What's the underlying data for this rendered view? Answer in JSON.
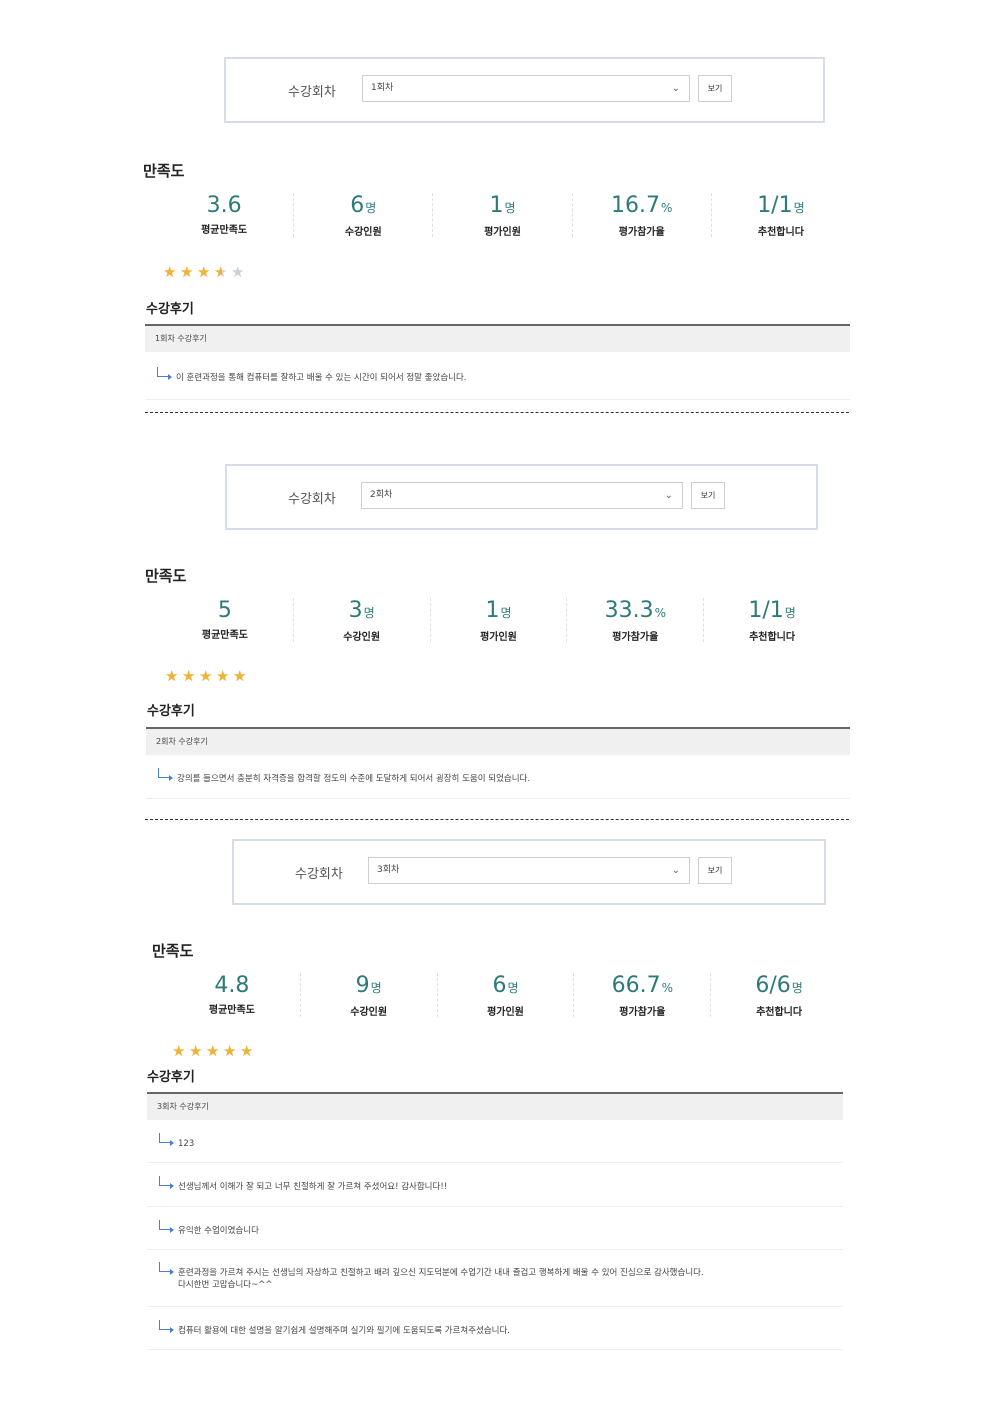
{
  "sections": [
    {
      "filter": {
        "label": "수강회차",
        "selected": "1회차",
        "button": "보기"
      },
      "satisfaction_title": "만족도",
      "stats": [
        {
          "value": "3.6",
          "unit": "",
          "label": "평균만족도"
        },
        {
          "value": "6",
          "unit": "명",
          "label": "수강인원"
        },
        {
          "value": "1",
          "unit": "명",
          "label": "평가인원"
        },
        {
          "value": "16.7",
          "unit": "%",
          "label": "평가참가율"
        },
        {
          "value": "1/1",
          "unit": "명",
          "label": "추천합니다"
        }
      ],
      "rating": 3.6,
      "review_title": "수강후기",
      "review_header": "1회차 수강후기",
      "reviews": [
        "이 훈련과정을 통해 컴퓨터를 잘하고 배울 수 있는 시간이 되어서 정말 좋았습니다."
      ]
    },
    {
      "filter": {
        "label": "수강회차",
        "selected": "2회차",
        "button": "보기"
      },
      "satisfaction_title": "만족도",
      "stats": [
        {
          "value": "5",
          "unit": "",
          "label": "평균만족도"
        },
        {
          "value": "3",
          "unit": "명",
          "label": "수강인원"
        },
        {
          "value": "1",
          "unit": "명",
          "label": "평가인원"
        },
        {
          "value": "33.3",
          "unit": "%",
          "label": "평가참가율"
        },
        {
          "value": "1/1",
          "unit": "명",
          "label": "추천합니다"
        }
      ],
      "rating": 5,
      "review_title": "수강후기",
      "review_header": "2회차 수강후기",
      "reviews": [
        "강의를 들으면서 충분히 자격증을 합격할 정도의 수준에 도달하게 되어서 굉장히 도움이 되었습니다."
      ]
    },
    {
      "filter": {
        "label": "수강회차",
        "selected": "3회차",
        "button": "보기"
      },
      "satisfaction_title": "만족도",
      "stats": [
        {
          "value": "4.8",
          "unit": "",
          "label": "평균만족도"
        },
        {
          "value": "9",
          "unit": "명",
          "label": "수강인원"
        },
        {
          "value": "6",
          "unit": "명",
          "label": "평가인원"
        },
        {
          "value": "66.7",
          "unit": "%",
          "label": "평가참가율"
        },
        {
          "value": "6/6",
          "unit": "명",
          "label": "추천합니다"
        }
      ],
      "rating": 4.8,
      "review_title": "수강후기",
      "review_header": "3회차 수강후기",
      "reviews": [
        "123",
        "선생님께서 이해가 잘 되고 너무 친절하게 잘 가르쳐 주셨어요! 감사합니다!!",
        "유익한 수업이였습니다",
        "훈련과정을 가르쳐 주시는 선생님의 자상하고 친절하고 배려 깊으신 지도덕분에 수업기간 내내 즐겁고 행복하게 배울 수 있어 진심으로 감사했습니다.\n다시한번 고맙습니다~^^",
        "컴퓨터 활용에 대한 설명을 알기쉽게 설명해주며 실기와 필기에 도움되도록 가르쳐주셨습니다."
      ]
    }
  ]
}
